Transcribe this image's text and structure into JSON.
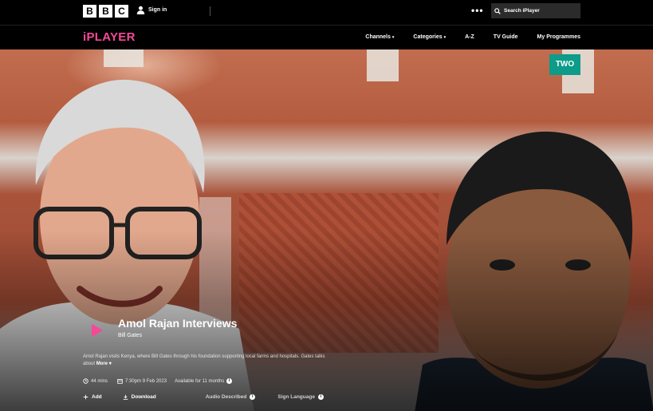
{
  "header": {
    "brand_letters": [
      "B",
      "B",
      "C"
    ],
    "signin_label": "Sign in",
    "more_glyph": "•••",
    "search_placeholder": "Search iPlayer"
  },
  "nav": {
    "logo": "iPLAYER",
    "items": [
      {
        "label": "Channels",
        "caret": "▾"
      },
      {
        "label": "Categories",
        "caret": "▾"
      },
      {
        "label": "A-Z",
        "caret": ""
      },
      {
        "label": "TV Guide",
        "caret": ""
      },
      {
        "label": "My Programmes",
        "caret": ""
      }
    ]
  },
  "hero": {
    "channel_badge": "TWO",
    "title": "Amol Rajan Interviews",
    "subtitle": "Bill Gates",
    "description": "Amol Rajan visits Kenya, where Bill Gates through his foundation supporting local farms and hospitals. Gates talks about",
    "more_label": "More",
    "more_caret": "▾",
    "meta": {
      "duration": "44 mins",
      "broadcast": "7:30pm 9 Feb 2023",
      "availability": "Available for 11 months"
    },
    "actions": {
      "add": "Add",
      "download": "Download",
      "audio_described": "Audio Described",
      "sign_language": "Sign Language"
    },
    "info_glyph": "i"
  },
  "colors": {
    "accent_pink": "#f54997",
    "badge_teal": "#0d9b8a",
    "background": "#000000"
  },
  "icons": [
    "user-icon",
    "search-icon",
    "more-dots-icon",
    "play-icon",
    "clock-icon",
    "calendar-icon",
    "info-icon",
    "plus-icon",
    "download-icon"
  ]
}
